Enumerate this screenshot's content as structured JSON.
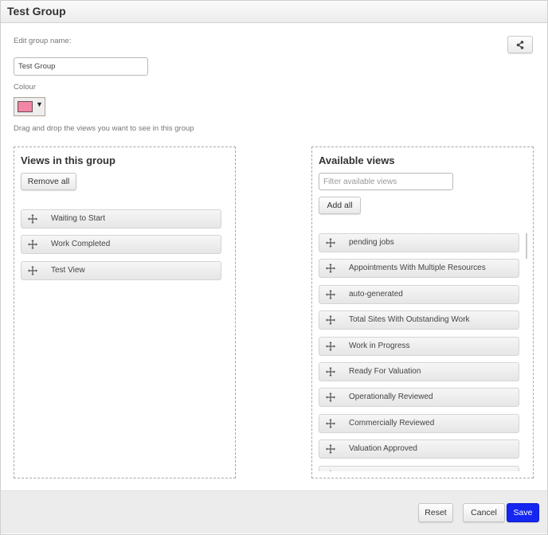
{
  "dialog": {
    "title": "Test Group"
  },
  "form": {
    "group_name_label": "Edit group name:",
    "group_name_value": "Test Group",
    "colour_label": "Colour",
    "colour_value": "#f286a6",
    "colour_arrow": "▼",
    "instructions": "Drag and drop the views you want to see in this group"
  },
  "share_button": {
    "icon": "share-icon"
  },
  "views_in_group": {
    "title": "Views in this group",
    "remove_all_label": "Remove all",
    "items": [
      {
        "label": "Waiting to Start",
        "icon": "move-icon"
      },
      {
        "label": "Work Completed",
        "icon": "move-icon"
      },
      {
        "label": "Test View",
        "icon": "move-icon"
      }
    ]
  },
  "available_views": {
    "title": "Available views",
    "filter_placeholder": "Filter available views",
    "filter_value": "",
    "add_all_label": "Add all",
    "items": [
      {
        "label": "pending jobs",
        "icon": "move-icon"
      },
      {
        "label": "Appointments With Multiple Resources",
        "icon": "move-icon"
      },
      {
        "label": "auto-generated",
        "icon": "move-icon"
      },
      {
        "label": "Total Sites With Outstanding Work",
        "icon": "move-icon"
      },
      {
        "label": "Work in Progress",
        "icon": "move-icon"
      },
      {
        "label": "Ready For Valuation",
        "icon": "move-icon"
      },
      {
        "label": "Operationally Reviewed",
        "icon": "move-icon"
      },
      {
        "label": "Commercially Reviewed",
        "icon": "move-icon"
      },
      {
        "label": "Valuation Approved",
        "icon": "move-icon"
      },
      {
        "label": "",
        "icon": "move-icon"
      }
    ]
  },
  "footer": {
    "reset_label": "Reset",
    "cancel_label": "Cancel",
    "save_label": "Save",
    "save_color": "#1526f0"
  }
}
